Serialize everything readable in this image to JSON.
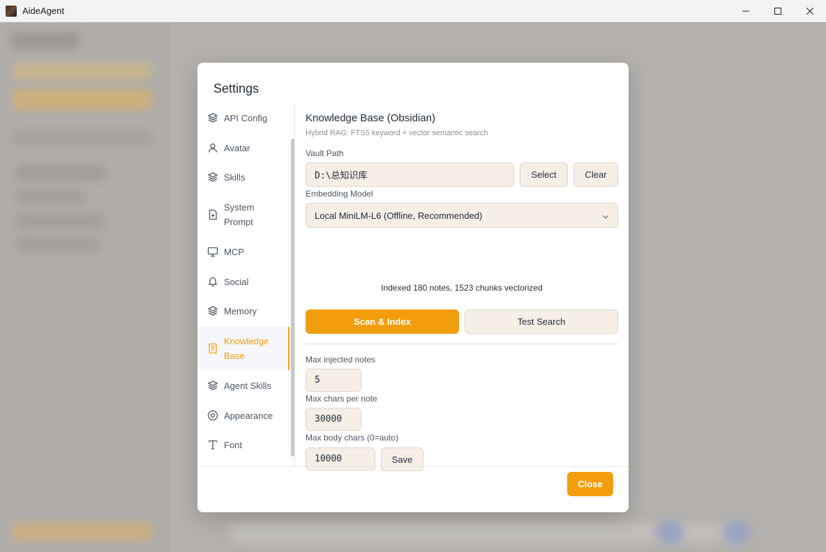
{
  "window": {
    "title": "AideAgent"
  },
  "dialog": {
    "title": "Settings",
    "nav": [
      {
        "label": "API Config",
        "icon": "layers-icon"
      },
      {
        "label": "Avatar",
        "icon": "user-icon"
      },
      {
        "label": "Skills",
        "icon": "layers-icon"
      },
      {
        "label": "System Prompt",
        "icon": "file-plus-icon"
      },
      {
        "label": "MCP",
        "icon": "monitor-icon"
      },
      {
        "label": "Social",
        "icon": "bell-icon"
      },
      {
        "label": "Memory",
        "icon": "layers-icon"
      },
      {
        "label": "Knowledge Base",
        "icon": "notebook-icon",
        "active": true
      },
      {
        "label": "Agent Skills",
        "icon": "layers-icon"
      },
      {
        "label": "Appearance",
        "icon": "gear-icon"
      },
      {
        "label": "Font",
        "icon": "type-icon"
      }
    ],
    "knowledge_base": {
      "title": "Knowledge Base (Obsidian)",
      "subtitle": "Hybrid RAG: FTS5 keyword + vector semantic search",
      "vault_path_label": "Vault Path",
      "vault_path_value": "D:\\总知识库",
      "select_label": "Select",
      "clear_label": "Clear",
      "embedding_label": "Embedding Model",
      "embedding_value": "Local MiniLM-L6 (Offline, Recommended)",
      "status": "Indexed 180 notes, 1523 chunks vectorized",
      "scan_label": "Scan & Index",
      "test_label": "Test Search",
      "max_notes_label": "Max injected notes",
      "max_notes_value": "5",
      "max_chars_label": "Max chars per note",
      "max_chars_value": "30000",
      "max_body_label": "Max body chars (0=auto)",
      "max_body_value": "10000",
      "save_label": "Save"
    },
    "close_label": "Close"
  },
  "colors": {
    "accent": "#f29e0c",
    "input_bg": "#f5efe6"
  }
}
